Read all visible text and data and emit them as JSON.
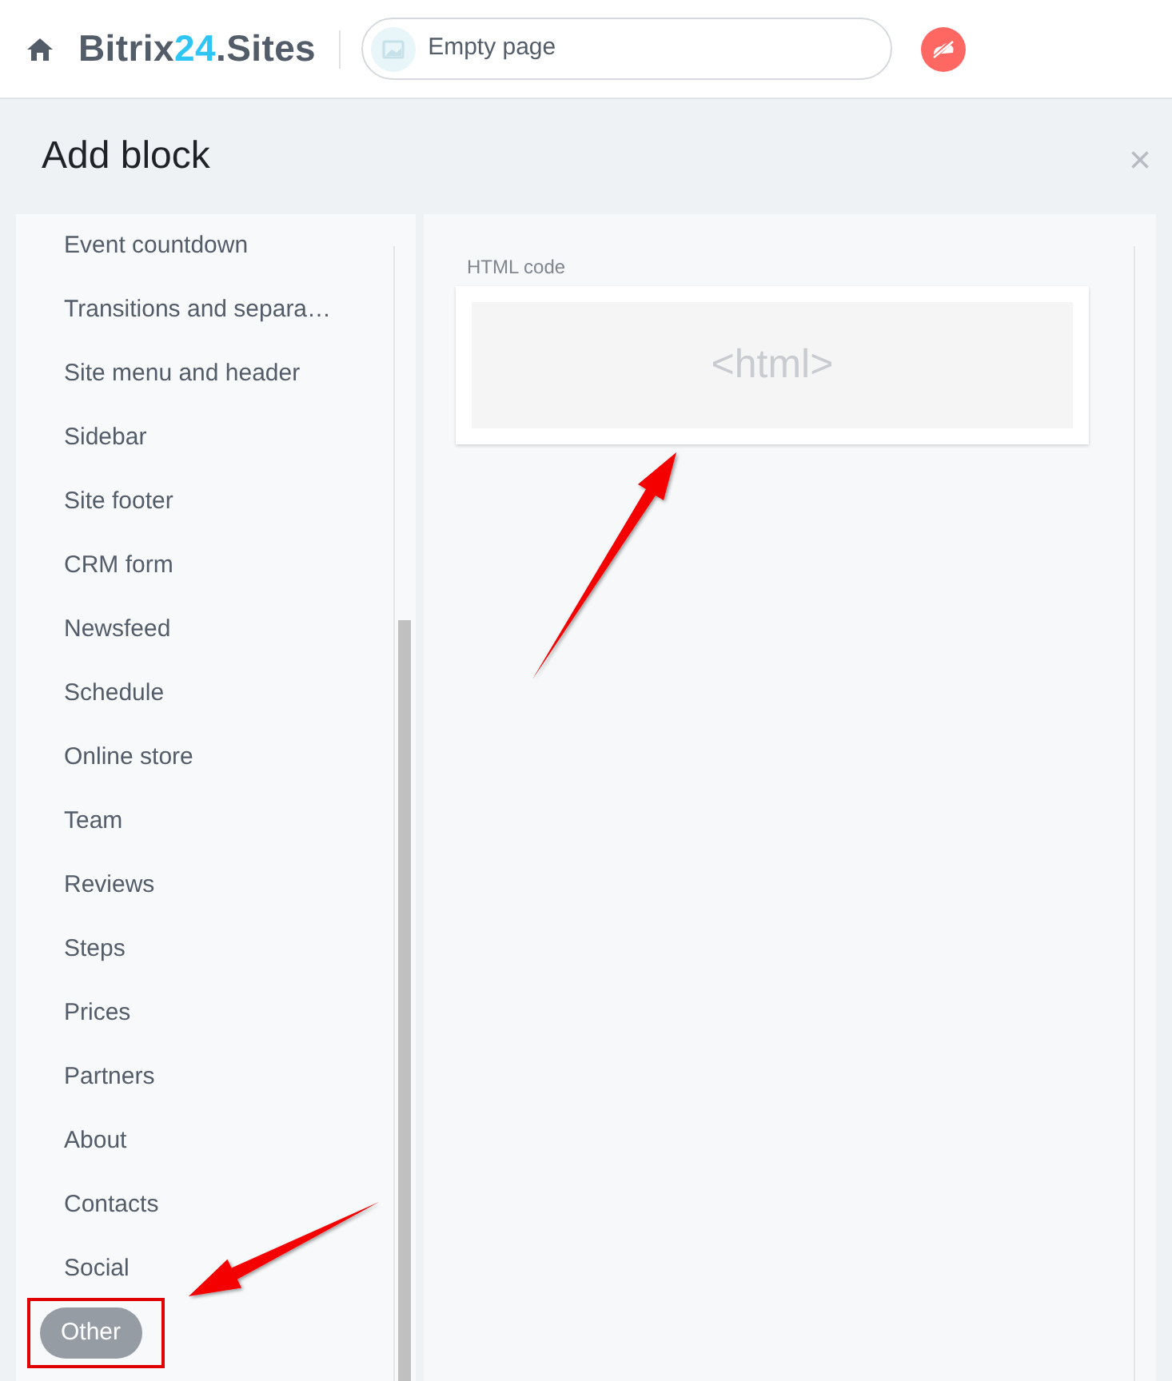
{
  "header": {
    "logo": {
      "brand": "Bitrix",
      "number": "24",
      "suffix": ".Sites"
    },
    "page_field": {
      "value": "Empty page"
    }
  },
  "dialog": {
    "title": "Add block",
    "close": "×"
  },
  "sidebar": {
    "items": [
      {
        "label": "Event countdown",
        "selected": false
      },
      {
        "label": "Transitions and separa…",
        "selected": false
      },
      {
        "label": "Site menu and header",
        "selected": false
      },
      {
        "label": "Sidebar",
        "selected": false
      },
      {
        "label": "Site footer",
        "selected": false
      },
      {
        "label": "CRM form",
        "selected": false
      },
      {
        "label": "Newsfeed",
        "selected": false
      },
      {
        "label": "Schedule",
        "selected": false
      },
      {
        "label": "Online store",
        "selected": false
      },
      {
        "label": "Team",
        "selected": false
      },
      {
        "label": "Reviews",
        "selected": false
      },
      {
        "label": "Steps",
        "selected": false
      },
      {
        "label": "Prices",
        "selected": false
      },
      {
        "label": "Partners",
        "selected": false
      },
      {
        "label": "About",
        "selected": false
      },
      {
        "label": "Contacts",
        "selected": false
      },
      {
        "label": "Social",
        "selected": false
      },
      {
        "label": "Other",
        "selected": true
      }
    ]
  },
  "blocks": [
    {
      "caption": "HTML code",
      "preview": "<html>"
    }
  ]
}
